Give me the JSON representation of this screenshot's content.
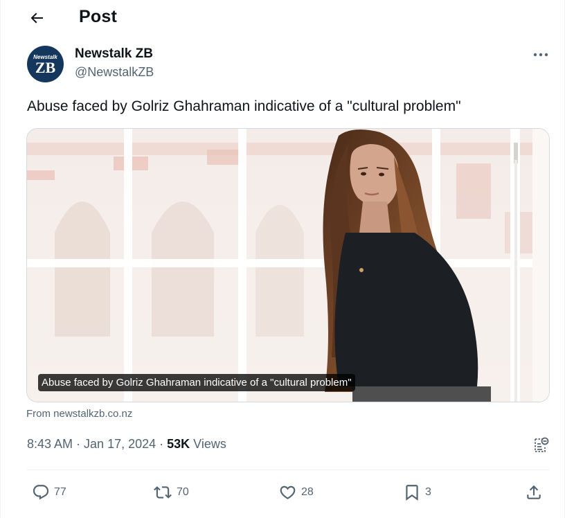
{
  "header": {
    "title": "Post",
    "back_icon": "arrow-left-icon"
  },
  "author": {
    "name": "Newstalk ZB",
    "handle": "@NewstalkZB",
    "avatar": {
      "small_text": "Newstalk",
      "big_text": "ZB",
      "bg": "#16375d"
    }
  },
  "tweet": {
    "text": "Abuse faced by Golriz Ghahraman indicative of a \"cultural problem\""
  },
  "card": {
    "caption": "Abuse faced by Golriz Ghahraman indicative of a \"cultural problem\"",
    "source": "From newstalkzb.co.nz"
  },
  "meta": {
    "time": "8:43 AM",
    "sep1": " · ",
    "date": "Jan 17, 2024",
    "sep2": " · ",
    "views_count": "53K",
    "views_label": " Views"
  },
  "actions": {
    "replies": "77",
    "reposts": "70",
    "likes": "28",
    "bookmarks": "3"
  },
  "colors": {
    "text": "#0f1419",
    "secondary": "#536471",
    "border": "#cfd9de"
  }
}
